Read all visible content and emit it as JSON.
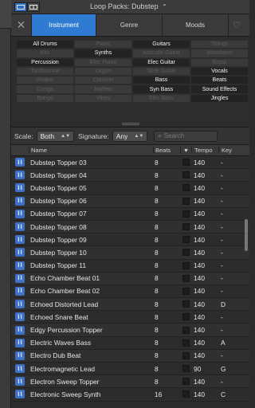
{
  "header": {
    "title_label": "Loop Packs:",
    "title_value": "Dubstep"
  },
  "tabs": [
    {
      "label": "Instrument",
      "active": true
    },
    {
      "label": "Genre",
      "active": false
    },
    {
      "label": "Moods",
      "active": false
    }
  ],
  "tag_grid": [
    {
      "label": "All Drums",
      "on": true
    },
    {
      "label": "Piano",
      "on": false
    },
    {
      "label": "Guitars",
      "on": true
    },
    {
      "label": "Strings",
      "on": false
    },
    {
      "label": "Kits",
      "on": false
    },
    {
      "label": "Synths",
      "on": true
    },
    {
      "label": "Acoustic Guitar",
      "on": false
    },
    {
      "label": "Woodwind",
      "on": false
    },
    {
      "label": "Percussion",
      "on": true
    },
    {
      "label": "Elec Piano",
      "on": false
    },
    {
      "label": "Elec Guitar",
      "on": true
    },
    {
      "label": "Brass",
      "on": false
    },
    {
      "label": "Tambourine",
      "on": false
    },
    {
      "label": "Organ",
      "on": false
    },
    {
      "label": "Slide Guitar",
      "on": false
    },
    {
      "label": "Vocals",
      "on": true
    },
    {
      "label": "Shaker",
      "on": false
    },
    {
      "label": "Clavinet",
      "on": false
    },
    {
      "label": "Bass",
      "on": true
    },
    {
      "label": "Beats",
      "on": true
    },
    {
      "label": "Conga",
      "on": false
    },
    {
      "label": "Mallets",
      "on": false
    },
    {
      "label": "Syn Bass",
      "on": true
    },
    {
      "label": "Sound Effects",
      "on": true
    },
    {
      "label": "Bongo",
      "on": false
    },
    {
      "label": "Vibes",
      "on": false
    },
    {
      "label": "Elec Bass",
      "on": false
    },
    {
      "label": "Jingles",
      "on": true
    }
  ],
  "filters": {
    "scale_label": "Scale:",
    "scale_value": "Both",
    "signature_label": "Signature:",
    "signature_value": "Any",
    "search_placeholder": "Search"
  },
  "columns": {
    "name": "Name",
    "beats": "Beats",
    "tempo": "Tempo",
    "key": "Key"
  },
  "rows": [
    {
      "name": "Dubstep Topper 03",
      "beats": "8",
      "tempo": "140",
      "key": "-"
    },
    {
      "name": "Dubstep Topper 04",
      "beats": "8",
      "tempo": "140",
      "key": "-"
    },
    {
      "name": "Dubstep Topper 05",
      "beats": "8",
      "tempo": "140",
      "key": "-"
    },
    {
      "name": "Dubstep Topper 06",
      "beats": "8",
      "tempo": "140",
      "key": "-"
    },
    {
      "name": "Dubstep Topper 07",
      "beats": "8",
      "tempo": "140",
      "key": "-"
    },
    {
      "name": "Dubstep Topper 08",
      "beats": "8",
      "tempo": "140",
      "key": "-"
    },
    {
      "name": "Dubstep Topper 09",
      "beats": "8",
      "tempo": "140",
      "key": "-"
    },
    {
      "name": "Dubstep Topper 10",
      "beats": "8",
      "tempo": "140",
      "key": "-"
    },
    {
      "name": "Dubstep Topper 11",
      "beats": "8",
      "tempo": "140",
      "key": "-"
    },
    {
      "name": "Echo Chamber Beat 01",
      "beats": "8",
      "tempo": "140",
      "key": "-"
    },
    {
      "name": "Echo Chamber Beat 02",
      "beats": "8",
      "tempo": "140",
      "key": "-"
    },
    {
      "name": "Echoed Distorted Lead",
      "beats": "8",
      "tempo": "140",
      "key": "D"
    },
    {
      "name": "Echoed Snare Beat",
      "beats": "8",
      "tempo": "140",
      "key": "-"
    },
    {
      "name": "Edgy Percussion Topper",
      "beats": "8",
      "tempo": "140",
      "key": "-"
    },
    {
      "name": "Electric Waves Bass",
      "beats": "8",
      "tempo": "140",
      "key": "A"
    },
    {
      "name": "Electro Dub Beat",
      "beats": "8",
      "tempo": "140",
      "key": "-"
    },
    {
      "name": "Electromagnetic Lead",
      "beats": "8",
      "tempo": "90",
      "key": "G"
    },
    {
      "name": "Electron Sweep Topper",
      "beats": "8",
      "tempo": "140",
      "key": "-"
    },
    {
      "name": "Electronic Sweep Synth",
      "beats": "16",
      "tempo": "140",
      "key": "C"
    }
  ]
}
